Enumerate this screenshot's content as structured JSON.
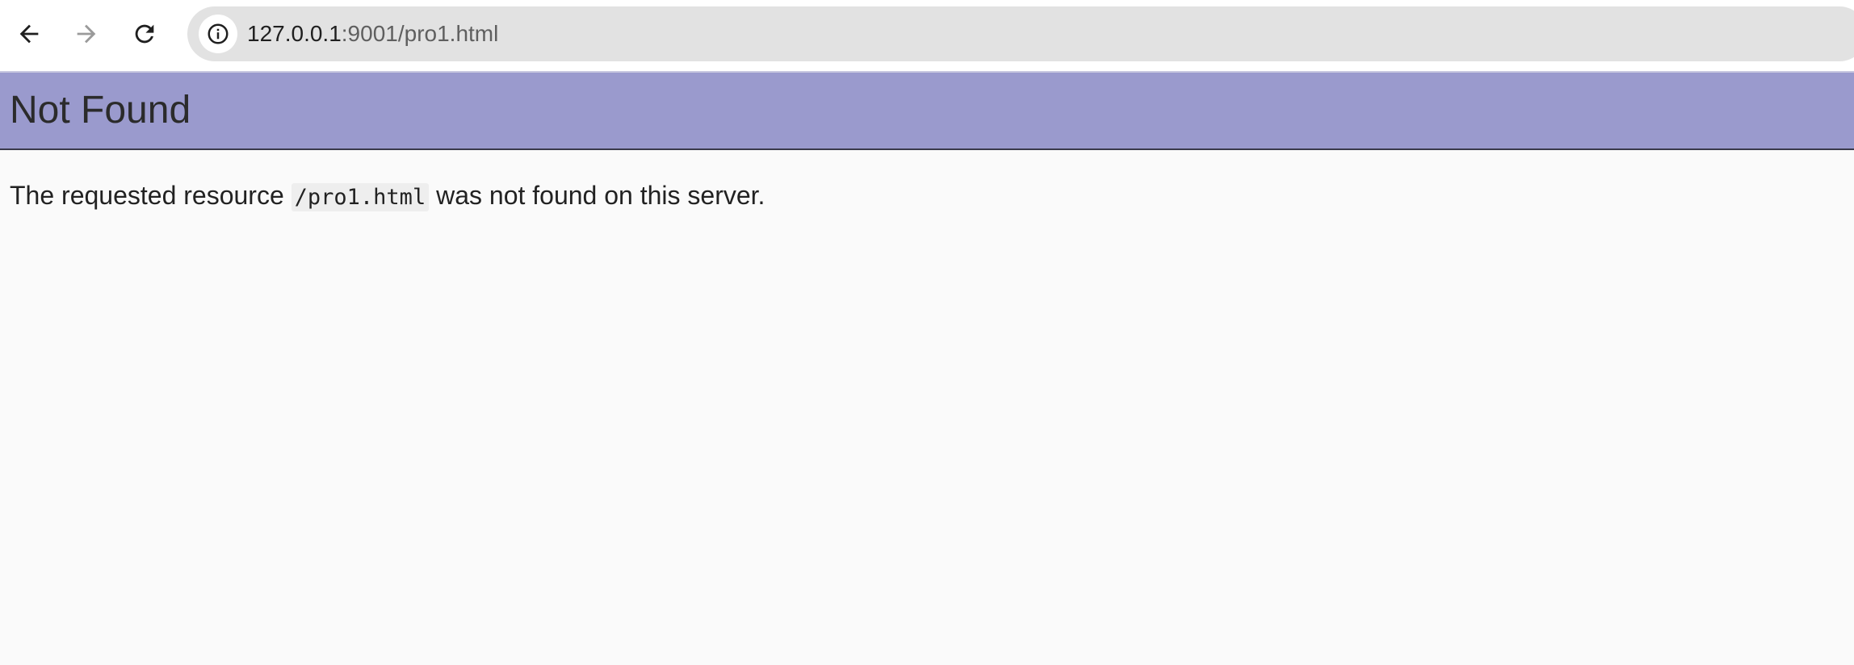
{
  "browser": {
    "url_host": "127.0.0.1",
    "url_rest": ":9001/pro1.html",
    "icons": {
      "back": "back-arrow-icon",
      "forward": "forward-arrow-icon",
      "reload": "reload-icon",
      "site_info": "info-icon"
    }
  },
  "page": {
    "title": "Not Found",
    "message_prefix": "The requested resource ",
    "resource_path": "/pro1.html",
    "message_suffix": " was not found on this server."
  },
  "colors": {
    "header_background": "#9a9acd",
    "page_background": "#fafafa",
    "omnibox_background": "#e2e2e2"
  }
}
